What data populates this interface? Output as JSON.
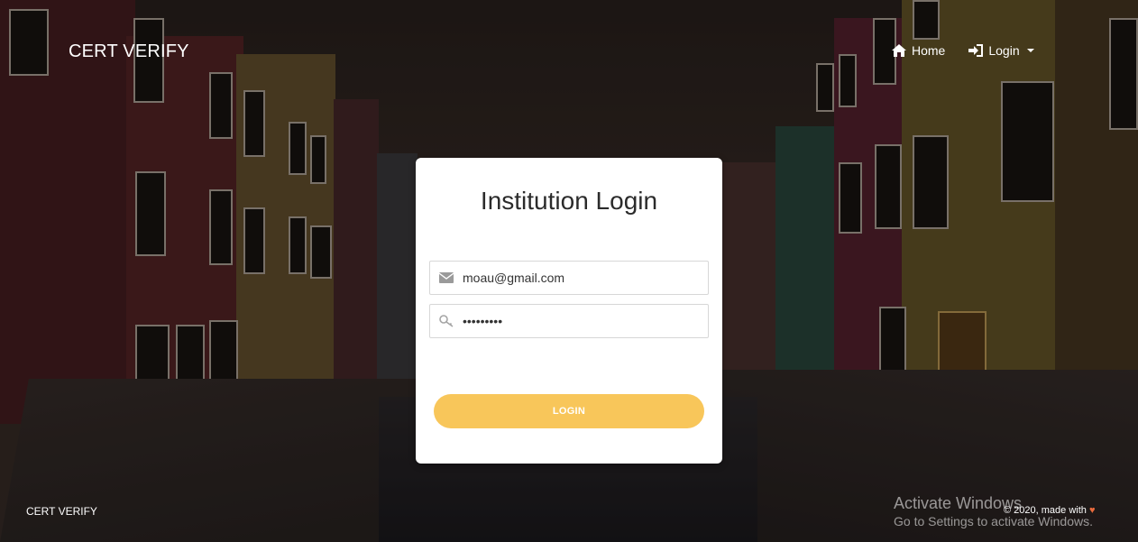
{
  "navbar": {
    "brand": "CERT VERIFY",
    "items": [
      {
        "label": "Home",
        "icon": "home-icon"
      },
      {
        "label": "Login",
        "icon": "sign-in-icon"
      }
    ]
  },
  "login_card": {
    "title": "Institution Login",
    "email_value": "moau@gmail.com",
    "password_value": "password1",
    "login_label": "LOGIN"
  },
  "footer": {
    "brand": "CERT VERIFY",
    "copyright": "© 2020, made with",
    "heart": "♥"
  },
  "watermark": {
    "line1": "Activate Windows",
    "line2": "Go to Settings to activate Windows."
  },
  "colors": {
    "accent": "#f8c65a",
    "heart": "#ea6b3d"
  }
}
